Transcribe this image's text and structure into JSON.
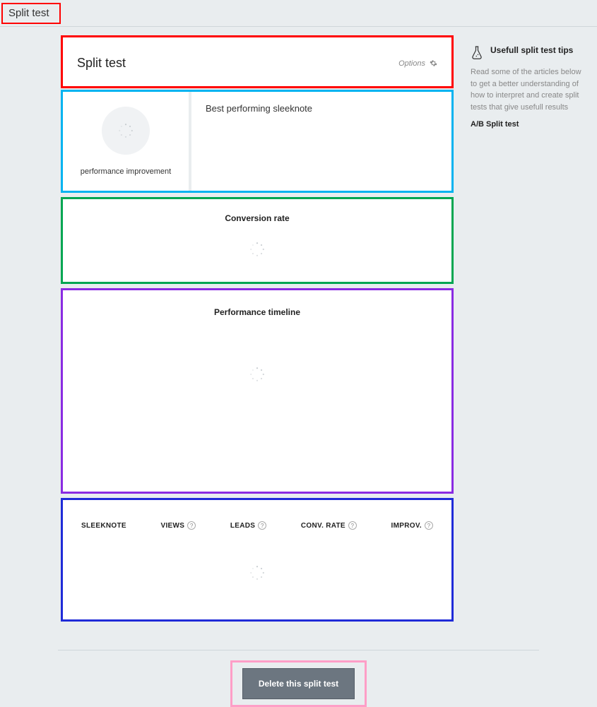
{
  "topbar": {
    "title": "Split test"
  },
  "header_card": {
    "title": "Split test",
    "options_label": "Options"
  },
  "kpi": {
    "left_label": "performance improvement",
    "right_title": "Best performing sleeknote"
  },
  "conversion": {
    "title": "Conversion rate"
  },
  "timeline": {
    "title": "Performance timeline"
  },
  "table": {
    "columns": [
      "SLEEKNOTE",
      "VIEWS",
      "LEADS",
      "CONV. RATE",
      "IMPROV."
    ]
  },
  "actions": {
    "delete_label": "Delete this split test"
  },
  "tips": {
    "heading": "Usefull split test tips",
    "body": "Read some of the articles below to get a better understanding of how to interpret and create split tests that give usefull results",
    "link_label": "A/B Split test"
  }
}
